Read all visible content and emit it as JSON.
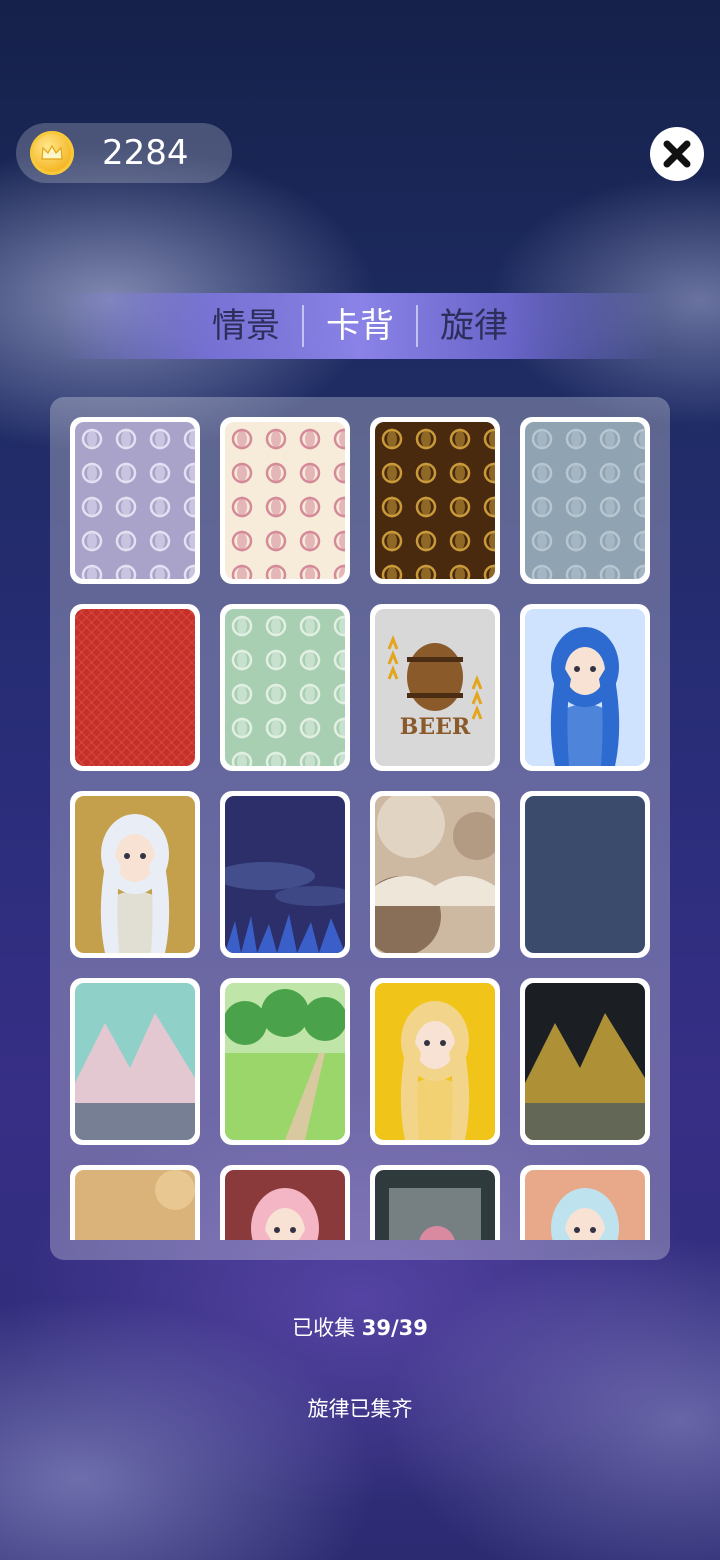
{
  "header": {
    "coin_count": "2284"
  },
  "tabs": [
    {
      "label": "情景",
      "active": false
    },
    {
      "label": "卡背",
      "active": true
    },
    {
      "label": "旋律",
      "active": false
    }
  ],
  "card_backs": [
    {
      "name": "lavender-lace-pattern",
      "colors": [
        "#a9a3c9",
        "#e4e0f2"
      ]
    },
    {
      "name": "cream-pink-damask",
      "colors": [
        "#f6ecd9",
        "#d58a9a"
      ]
    },
    {
      "name": "brown-gold-floral",
      "colors": [
        "#4a2a0e",
        "#c99a3a"
      ]
    },
    {
      "name": "grey-blue-damask",
      "colors": [
        "#8fa3b2",
        "#b7c6d1"
      ]
    },
    {
      "name": "red-lattice",
      "colors": [
        "#c6302a",
        "#e05a4a"
      ]
    },
    {
      "name": "mint-green-damask",
      "colors": [
        "#a9cfb3",
        "#e2f0e4"
      ]
    },
    {
      "name": "beer-barrel",
      "colors": [
        "#d8d8d8",
        "#8a5a2b"
      ],
      "label": "BEER"
    },
    {
      "name": "blue-hair-anime-girl",
      "colors": [
        "#2d6bd0",
        "#cfe3ff"
      ]
    },
    {
      "name": "white-hair-anime-girl",
      "colors": [
        "#e9eef6",
        "#c4a04d"
      ]
    },
    {
      "name": "night-meadow",
      "colors": [
        "#2c2f6a",
        "#5a6fb0"
      ]
    },
    {
      "name": "moons-in-clouds",
      "colors": [
        "#cdb8a2",
        "#8a6f58"
      ]
    },
    {
      "name": "slate-blue-plain",
      "colors": [
        "#3b4b6b",
        "#4a5a7a"
      ]
    },
    {
      "name": "pastel-mountain-lake",
      "colors": [
        "#8fd0c8",
        "#f2c7d2"
      ]
    },
    {
      "name": "green-park-path",
      "colors": [
        "#4aa24a",
        "#9bd66a"
      ]
    },
    {
      "name": "blonde-anime-girl",
      "colors": [
        "#f2d58a",
        "#f0c419"
      ]
    },
    {
      "name": "golden-night-hills",
      "colors": [
        "#1b1f24",
        "#c8a53a"
      ]
    },
    {
      "name": "golden-sand",
      "colors": [
        "#d9b37a",
        "#e8c890"
      ]
    },
    {
      "name": "pink-flower-girl",
      "colors": [
        "#f4b6c4",
        "#8a3a3a"
      ]
    },
    {
      "name": "ice-cube-flower",
      "colors": [
        "#2f3a3c",
        "#d98aa0"
      ]
    },
    {
      "name": "bamboo-girl",
      "colors": [
        "#bfe3ee",
        "#e8a98a"
      ]
    }
  ],
  "footer": {
    "collected_label": "已收集",
    "collected_count": "39/39",
    "melody_status": "旋律已集齐"
  },
  "accent_colors": {
    "tab_bar": "#8f86ef",
    "coin_gold": "#f5b320"
  }
}
